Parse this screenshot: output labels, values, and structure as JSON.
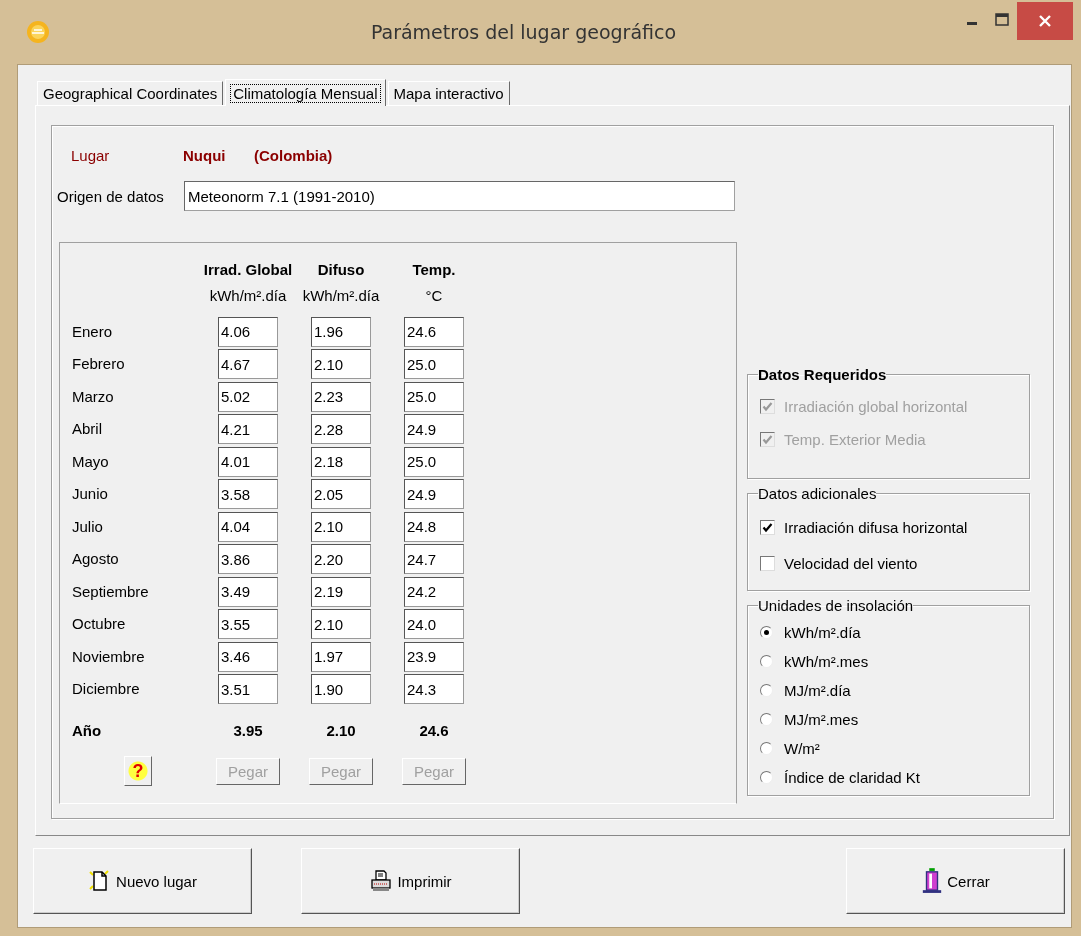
{
  "window": {
    "title": "Parámetros del lugar geográfico"
  },
  "tabs": [
    {
      "label": "Geographical Coordinates",
      "selected": false
    },
    {
      "label": "Climatología Mensual",
      "selected": true
    },
    {
      "label": "Mapa interactivo",
      "selected": false
    }
  ],
  "location": {
    "label": "Lugar",
    "name": "Nuqui",
    "country": "(Colombia)"
  },
  "data_source": {
    "label": "Origen de datos",
    "value": "Meteonorm 7.1 (1991-2010)"
  },
  "table": {
    "columns": [
      {
        "title": "Irrad. Global",
        "unit": "kWh/m².día"
      },
      {
        "title": "Difuso",
        "unit": "kWh/m².día"
      },
      {
        "title": "Temp.",
        "unit": "°C"
      }
    ],
    "rows": [
      {
        "month": "Enero",
        "values": [
          "4.06",
          "1.96",
          "24.6"
        ]
      },
      {
        "month": "Febrero",
        "values": [
          "4.67",
          "2.10",
          "25.0"
        ]
      },
      {
        "month": "Marzo",
        "values": [
          "5.02",
          "2.23",
          "25.0"
        ]
      },
      {
        "month": "Abril",
        "values": [
          "4.21",
          "2.28",
          "24.9"
        ]
      },
      {
        "month": "Mayo",
        "values": [
          "4.01",
          "2.18",
          "25.0"
        ]
      },
      {
        "month": "Junio",
        "values": [
          "3.58",
          "2.05",
          "24.9"
        ]
      },
      {
        "month": "Julio",
        "values": [
          "4.04",
          "2.10",
          "24.8"
        ]
      },
      {
        "month": "Agosto",
        "values": [
          "3.86",
          "2.20",
          "24.7"
        ]
      },
      {
        "month": "Septiembre",
        "values": [
          "3.49",
          "2.19",
          "24.2"
        ]
      },
      {
        "month": "Octubre",
        "values": [
          "3.55",
          "2.10",
          "24.0"
        ]
      },
      {
        "month": "Noviembre",
        "values": [
          "3.46",
          "1.97",
          "23.9"
        ]
      },
      {
        "month": "Diciembre",
        "values": [
          "3.51",
          "1.90",
          "24.3"
        ]
      }
    ],
    "total": {
      "label": "Año",
      "values": [
        "3.95",
        "2.10",
        "24.6"
      ]
    },
    "help_button": {
      "label": "?"
    },
    "paste_buttons": [
      {
        "label": "Pegar",
        "disabled": true
      },
      {
        "label": "Pegar",
        "disabled": true
      },
      {
        "label": "Pegar",
        "disabled": true
      }
    ]
  },
  "required_data": {
    "title": "Datos Requeridos",
    "items": [
      {
        "label": "Irradiación global horizontal",
        "checked": true,
        "disabled": true
      },
      {
        "label": "Temp. Exterior Media",
        "checked": true,
        "disabled": true
      }
    ]
  },
  "additional_data": {
    "title": "Datos adicionales",
    "items": [
      {
        "label": "Irradiación difusa horizontal",
        "checked": true,
        "disabled": false
      },
      {
        "label": "Velocidad del viento",
        "checked": false,
        "disabled": false
      }
    ]
  },
  "insolation_units": {
    "title": "Unidades de insolación",
    "options": [
      {
        "label": "kWh/m².día",
        "selected": true
      },
      {
        "label": "kWh/m².mes",
        "selected": false
      },
      {
        "label": "MJ/m².día",
        "selected": false
      },
      {
        "label": "MJ/m².mes",
        "selected": false
      },
      {
        "label": "W/m²",
        "selected": false
      },
      {
        "label": "Índice de claridad Kt",
        "selected": false
      }
    ]
  },
  "buttons": [
    {
      "label": "Nuevo lugar",
      "kind": "new"
    },
    {
      "label": "Imprimir",
      "kind": "print"
    },
    {
      "label": "Cerrar",
      "kind": "close"
    }
  ]
}
